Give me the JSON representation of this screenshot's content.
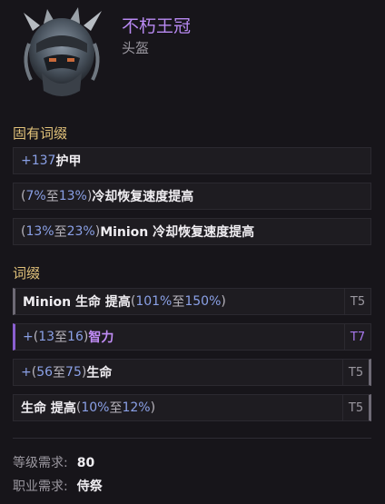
{
  "item": {
    "name": "不朽王冠",
    "type": "头盔",
    "icon": "spiked-helmet-icon"
  },
  "implicit": {
    "title": "固有词缀",
    "rows": [
      {
        "plus": "+",
        "v1": "137",
        "text": " 护甲"
      },
      {
        "pre": "(",
        "v1": "7%",
        "mid": " 至 ",
        "v2": "13%",
        "post": ")",
        "text": " 冷却恢复速度提高"
      },
      {
        "pre": "(",
        "v1": "13%",
        "mid": " 至 ",
        "v2": "23%",
        "post": ")",
        "text": " Minion 冷却恢复速度提高"
      }
    ]
  },
  "affixes": {
    "title": "词缀",
    "rows": [
      {
        "text": "Minion 生命 提高 ",
        "pre": "(",
        "v1": "101%",
        "mid": " 至 ",
        "v2": "150%",
        "post": ")",
        "tier": "T5"
      },
      {
        "plus": "+",
        "pre": "(",
        "v1": "13",
        "mid": " 至 ",
        "v2": "16",
        "post": ")",
        "text": " 智力",
        "tier": "T7"
      },
      {
        "plus": "+",
        "pre": "(",
        "v1": "56",
        "mid": " 至 ",
        "v2": "75",
        "post": ")",
        "text": " 生命",
        "tier": "T5"
      },
      {
        "text": "生命 提高 ",
        "pre": "(",
        "v1": "10%",
        "mid": " 至 ",
        "v2": "12%",
        "post": ")",
        "tier": "T5"
      }
    ]
  },
  "requirements": {
    "level_label": "等级需求:",
    "level_value": "80",
    "class_label": "职业需求:",
    "class_value": "侍祭"
  },
  "colors": {
    "name_purple": "#b889f2",
    "section_gold": "#e2c27a",
    "value_blue": "#8aa0e6",
    "tier_purple": "#a878ee"
  }
}
